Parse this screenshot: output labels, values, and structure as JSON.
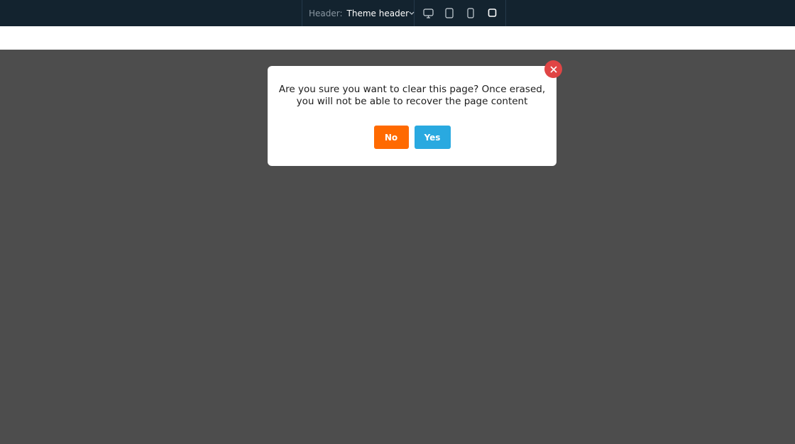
{
  "topbar": {
    "header_label": "Header:",
    "header_value": "Theme header",
    "icons": {
      "dropdown": "chevron-down-icon",
      "desktop": "desktop-icon",
      "tablet": "tablet-icon",
      "mobile": "mobile-icon",
      "custom": "square-icon"
    }
  },
  "dialog": {
    "message": "Are you sure you want to clear this page? Once erased, you will not be able to recover the page content",
    "no_label": "No",
    "yes_label": "Yes",
    "close_icon": "close-icon"
  },
  "colors": {
    "topbar_bg": "#13232f",
    "overlay_bg": "#4d4d4d",
    "no_button": "#ff6a00",
    "yes_button": "#29a9e0",
    "close_button": "#e04545"
  }
}
